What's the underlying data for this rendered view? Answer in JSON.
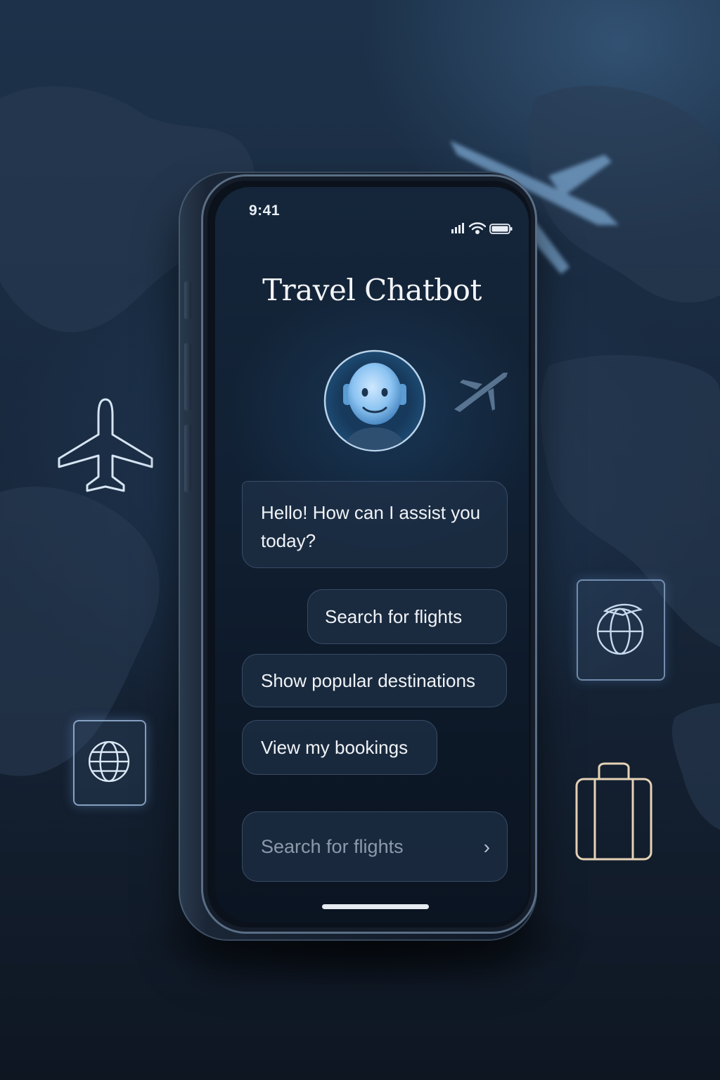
{
  "status": {
    "time": "9:41"
  },
  "app": {
    "title": "Travel Chatbot"
  },
  "chat": {
    "bot_message": "Hello! How can I assist you today?",
    "options": [
      "Search for flights",
      "Show popular destinations",
      "View my bookings"
    ]
  },
  "input": {
    "text": "Search for flights",
    "send_icon": "chevron-right-icon"
  },
  "decor": {
    "icons": [
      "airplane-outline-icon",
      "globe-icon",
      "globe-plane-icon",
      "suitcase-icon"
    ]
  },
  "colors": {
    "accent": "#7fb8ea",
    "background": "#15263a",
    "text": "#f0f3f7"
  }
}
